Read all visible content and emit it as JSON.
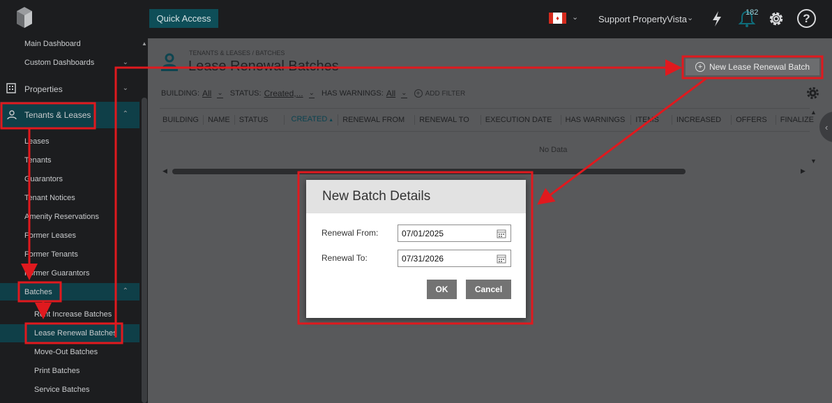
{
  "topbar": {
    "quick_access": "Quick Access",
    "user": "Support PropertyVista",
    "notifications_count": "182"
  },
  "sidebar": {
    "main_dashboard": "Main Dashboard",
    "custom_dashboards": "Custom Dashboards",
    "properties": "Properties",
    "tenants_leases": "Tenants & Leases",
    "sub": [
      "Leases",
      "Tenants",
      "Guarantors",
      "Tenant Notices",
      "Amenity Reservations",
      "Former Leases",
      "Former Tenants",
      "Former Guarantors"
    ],
    "batches": "Batches",
    "batch_items": [
      "Rent Increase Batches",
      "Lease Renewal Batches",
      "Move-Out Batches",
      "Print Batches",
      "Service Batches"
    ]
  },
  "page": {
    "breadcrumb": "TENANTS & LEASES / BATCHES",
    "title": "Lease Renewal Batches",
    "new_batch_button": "New Lease Renewal Batch"
  },
  "filters": {
    "building_label": "BUILDING:",
    "building_value": "All",
    "status_label": "STATUS:",
    "status_value": "Created,...",
    "warnings_label": "HAS WARNINGS:",
    "warnings_value": "All",
    "add_filter": "ADD FILTER"
  },
  "table": {
    "columns": [
      "BUILDING",
      "NAME",
      "STATUS",
      "CREATED",
      "RENEWAL FROM",
      "RENEWAL TO",
      "EXECUTION DATE",
      "HAS WARNINGS",
      "ITEMS",
      "INCREASED",
      "OFFERS",
      "FINALIZE"
    ],
    "sorted_column": "CREATED",
    "empty_text": "No Data"
  },
  "dialog": {
    "title": "New Batch Details",
    "renewal_from_label": "Renewal From:",
    "renewal_from_value": "07/01/2025",
    "renewal_to_label": "Renewal To:",
    "renewal_to_value": "07/31/2026",
    "ok": "OK",
    "cancel": "Cancel"
  },
  "colors": {
    "accent": "#0f3f48",
    "annotation": "#e0191e",
    "button_gray": "#737373"
  }
}
